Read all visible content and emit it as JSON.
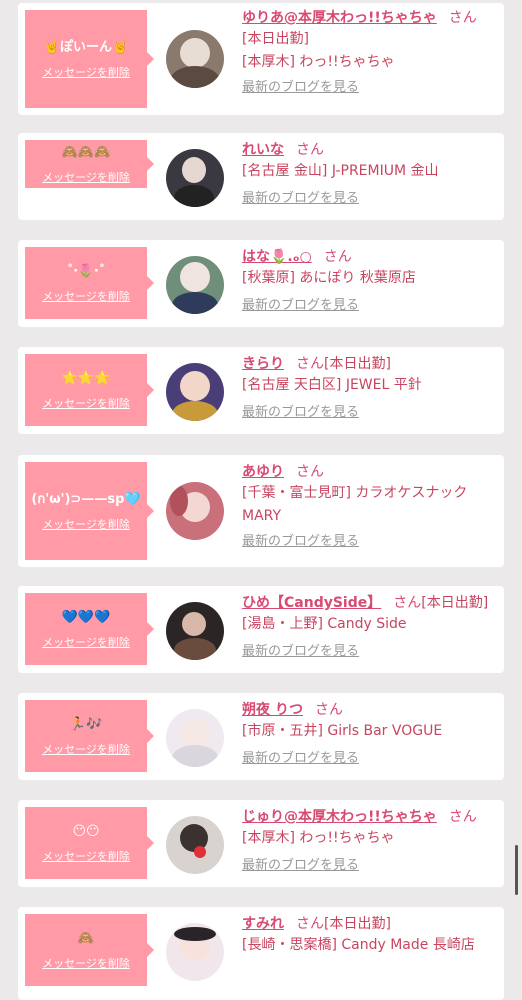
{
  "delete_label": "メッセージを削除",
  "blog_label": "最新のブログを見る",
  "san_label": "さん",
  "items": [
    {
      "message": "🤘ぽいーん🤘",
      "name": "ゆりあ@本厚木わっ!!ちゃちゃ",
      "tag": "",
      "shop": "[本日出勤]",
      "shop2": "[本厚木] わっ!!ちゃちゃ"
    },
    {
      "message": "🙈🙈🙈",
      "name": "れいな",
      "tag": "",
      "shop": "[名古屋 金山] J-PREMIUM 金山",
      "shop2": ""
    },
    {
      "message": "˚‧🌷‧˚",
      "name": "はな🌷.ₒ○",
      "tag": "",
      "shop": "[秋葉原] あにぽり 秋葉原店",
      "shop2": ""
    },
    {
      "message": "🌟🌟🌟",
      "name": "きらり",
      "tag": "[本日出勤]",
      "shop": "[名古屋 天白区] JEWEL 平針",
      "shop2": ""
    },
    {
      "message": "(ก'ω')⊃——sp🩵",
      "name": "あゆり",
      "tag": "",
      "shop": "[千葉・富士見町] カラオケスナック",
      "shop2": "MARY"
    },
    {
      "message": "💙💙💙",
      "name": "ひめ【CandySide】",
      "tag": "[本日出勤]",
      "shop": "[湯島・上野] Candy Side",
      "shop2": ""
    },
    {
      "message": "🏃🎶",
      "name": "朔夜 りつ",
      "tag": "",
      "shop": "[市原・五井] Girls Bar VOGUE",
      "shop2": ""
    },
    {
      "message": "😶😶",
      "name": "じゅり@本厚木わっ!!ちゃちゃ",
      "tag": "",
      "shop": "[本厚木] わっ!!ちゃちゃ",
      "shop2": ""
    },
    {
      "message": "🙈",
      "name": "すみれ",
      "tag": "[本日出勤]",
      "shop": "[長崎・思案橋] Candy Made 長崎店",
      "shop2": ""
    }
  ],
  "avatar_colors": [
    "#8a7a6e",
    "#3a3840",
    "#6f8f7a",
    "#4a3e78",
    "#c9707a",
    "#2b2526",
    "#eeeaf0",
    "#d9d3d0",
    "#f1e6ec"
  ]
}
